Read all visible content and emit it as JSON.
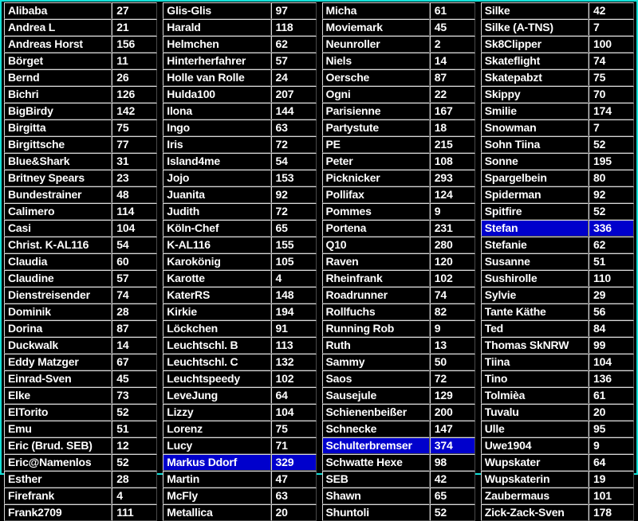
{
  "window": {
    "title": "Ranking Table",
    "border_color": "#13e0d8",
    "background": "#000000",
    "text_color": "#ffffff",
    "selection_color": "#0000cc"
  },
  "columns": [
    {
      "name": "column-1",
      "rows": [
        {
          "name": "Alibaba",
          "score": "27",
          "selected": false
        },
        {
          "name": "Andrea L",
          "score": "21",
          "selected": false
        },
        {
          "name": "Andreas Horst",
          "score": "156",
          "selected": false
        },
        {
          "name": "Börget",
          "score": "11",
          "selected": false
        },
        {
          "name": "Bernd",
          "score": "26",
          "selected": false
        },
        {
          "name": "Bichri",
          "score": "126",
          "selected": false
        },
        {
          "name": "BigBirdy",
          "score": "142",
          "selected": false
        },
        {
          "name": "Birgitta",
          "score": "75",
          "selected": false
        },
        {
          "name": "Birgittsche",
          "score": "77",
          "selected": false
        },
        {
          "name": "Blue&Shark",
          "score": "31",
          "selected": false
        },
        {
          "name": "Britney Spears",
          "score": "23",
          "selected": false
        },
        {
          "name": "Bundestrainer",
          "score": "48",
          "selected": false
        },
        {
          "name": "Calimero",
          "score": "114",
          "selected": false
        },
        {
          "name": "Casi",
          "score": "104",
          "selected": false
        },
        {
          "name": "Christ. K-AL116",
          "score": "54",
          "selected": false
        },
        {
          "name": "Claudia",
          "score": "60",
          "selected": false
        },
        {
          "name": "Claudine",
          "score": "57",
          "selected": false
        },
        {
          "name": "Dienstreisender",
          "score": "74",
          "selected": false
        },
        {
          "name": "Dominik",
          "score": "28",
          "selected": false
        },
        {
          "name": "Dorina",
          "score": "87",
          "selected": false
        },
        {
          "name": "Duckwalk",
          "score": "14",
          "selected": false
        },
        {
          "name": "Eddy Matzger",
          "score": "67",
          "selected": false
        },
        {
          "name": "Einrad-Sven",
          "score": "45",
          "selected": false
        },
        {
          "name": "Elke",
          "score": "73",
          "selected": false
        },
        {
          "name": "ElTorito",
          "score": "52",
          "selected": false
        },
        {
          "name": "Emu",
          "score": "51",
          "selected": false
        },
        {
          "name": "Eric (Brud. SEB)",
          "score": "12",
          "selected": false
        },
        {
          "name": "Eric@Namenlos",
          "score": "52",
          "selected": false
        },
        {
          "name": "Esther",
          "score": "28",
          "selected": false
        },
        {
          "name": "Firefrank",
          "score": "4",
          "selected": false
        },
        {
          "name": "Frank2709",
          "score": "111",
          "selected": false
        }
      ]
    },
    {
      "name": "column-2",
      "rows": [
        {
          "name": "Glis-Glis",
          "score": "97",
          "selected": false
        },
        {
          "name": "Harald",
          "score": "118",
          "selected": false
        },
        {
          "name": "Helmchen",
          "score": "62",
          "selected": false
        },
        {
          "name": "Hinterherfahrer",
          "score": "57",
          "selected": false
        },
        {
          "name": "Holle van Rolle",
          "score": "24",
          "selected": false
        },
        {
          "name": "Hulda100",
          "score": "207",
          "selected": false
        },
        {
          "name": "Ilona",
          "score": "144",
          "selected": false
        },
        {
          "name": "Ingo",
          "score": "63",
          "selected": false
        },
        {
          "name": "Iris",
          "score": "72",
          "selected": false
        },
        {
          "name": "Island4me",
          "score": "54",
          "selected": false
        },
        {
          "name": "Jojo",
          "score": "153",
          "selected": false
        },
        {
          "name": "Juanita",
          "score": "92",
          "selected": false
        },
        {
          "name": "Judith",
          "score": "72",
          "selected": false
        },
        {
          "name": "Köln-Chef",
          "score": "65",
          "selected": false
        },
        {
          "name": "K-AL116",
          "score": "155",
          "selected": false
        },
        {
          "name": "Karokönig",
          "score": "105",
          "selected": false
        },
        {
          "name": "Karotte",
          "score": "4",
          "selected": false
        },
        {
          "name": "KaterRS",
          "score": "148",
          "selected": false
        },
        {
          "name": "Kirkie",
          "score": "194",
          "selected": false
        },
        {
          "name": "Löckchen",
          "score": "91",
          "selected": false
        },
        {
          "name": "Leuchtschl. B",
          "score": "113",
          "selected": false
        },
        {
          "name": "Leuchtschl. C",
          "score": "132",
          "selected": false
        },
        {
          "name": "Leuchtspeedy",
          "score": "102",
          "selected": false
        },
        {
          "name": "LeveJung",
          "score": "64",
          "selected": false
        },
        {
          "name": "Lizzy",
          "score": "104",
          "selected": false
        },
        {
          "name": "Lorenz",
          "score": "75",
          "selected": false
        },
        {
          "name": "Lucy",
          "score": "71",
          "selected": false
        },
        {
          "name": "Markus Ddorf",
          "score": "329",
          "selected": true
        },
        {
          "name": "Martin",
          "score": "47",
          "selected": false
        },
        {
          "name": "McFly",
          "score": "63",
          "selected": false
        },
        {
          "name": "Metallica",
          "score": "20",
          "selected": false
        }
      ]
    },
    {
      "name": "column-3",
      "rows": [
        {
          "name": "Micha",
          "score": "61",
          "selected": false
        },
        {
          "name": "Moviemark",
          "score": "45",
          "selected": false
        },
        {
          "name": "Neunroller",
          "score": "2",
          "selected": false
        },
        {
          "name": "Niels",
          "score": "14",
          "selected": false
        },
        {
          "name": "Oersche",
          "score": "87",
          "selected": false
        },
        {
          "name": "Ogni",
          "score": "22",
          "selected": false
        },
        {
          "name": "Parisienne",
          "score": "167",
          "selected": false
        },
        {
          "name": "Partystute",
          "score": "18",
          "selected": false
        },
        {
          "name": "PE",
          "score": "215",
          "selected": false
        },
        {
          "name": "Peter",
          "score": "108",
          "selected": false
        },
        {
          "name": "Picknicker",
          "score": "293",
          "selected": false
        },
        {
          "name": "Pollifax",
          "score": "124",
          "selected": false
        },
        {
          "name": "Pommes",
          "score": "9",
          "selected": false
        },
        {
          "name": "Portena",
          "score": "231",
          "selected": false
        },
        {
          "name": "Q10",
          "score": "280",
          "selected": false
        },
        {
          "name": "Raven",
          "score": "120",
          "selected": false
        },
        {
          "name": "Rheinfrank",
          "score": "102",
          "selected": false
        },
        {
          "name": "Roadrunner",
          "score": "74",
          "selected": false
        },
        {
          "name": "Rollfuchs",
          "score": "82",
          "selected": false
        },
        {
          "name": "Running Rob",
          "score": "9",
          "selected": false
        },
        {
          "name": "Ruth",
          "score": "13",
          "selected": false
        },
        {
          "name": "Sammy",
          "score": "50",
          "selected": false
        },
        {
          "name": "Saos",
          "score": "72",
          "selected": false
        },
        {
          "name": "Sausejule",
          "score": "129",
          "selected": false
        },
        {
          "name": "Schienenbeißer",
          "score": "200",
          "selected": false
        },
        {
          "name": "Schnecke",
          "score": "147",
          "selected": false
        },
        {
          "name": "Schulterbremser",
          "score": "374",
          "selected": true
        },
        {
          "name": "Schwatte Hexe",
          "score": "98",
          "selected": false
        },
        {
          "name": "SEB",
          "score": "42",
          "selected": false
        },
        {
          "name": "Shawn",
          "score": "65",
          "selected": false
        },
        {
          "name": "Shuntoli",
          "score": "52",
          "selected": false
        }
      ]
    },
    {
      "name": "column-4",
      "rows": [
        {
          "name": "Silke",
          "score": "42",
          "selected": false
        },
        {
          "name": "Silke (A-TNS)",
          "score": "7",
          "selected": false
        },
        {
          "name": "Sk8Clipper",
          "score": "100",
          "selected": false
        },
        {
          "name": "Skateflight",
          "score": "74",
          "selected": false
        },
        {
          "name": "Skatepabzt",
          "score": "75",
          "selected": false
        },
        {
          "name": "Skippy",
          "score": "70",
          "selected": false
        },
        {
          "name": "Smilie",
          "score": "174",
          "selected": false
        },
        {
          "name": "Snowman",
          "score": "7",
          "selected": false
        },
        {
          "name": "Sohn Tiina",
          "score": "52",
          "selected": false
        },
        {
          "name": "Sonne",
          "score": "195",
          "selected": false
        },
        {
          "name": "Spargelbein",
          "score": "80",
          "selected": false
        },
        {
          "name": "Spiderman",
          "score": "92",
          "selected": false
        },
        {
          "name": "Spitfire",
          "score": "52",
          "selected": false
        },
        {
          "name": "Stefan",
          "score": "336",
          "selected": true
        },
        {
          "name": "Stefanie",
          "score": "62",
          "selected": false
        },
        {
          "name": "Susanne",
          "score": "51",
          "selected": false
        },
        {
          "name": "Sushirolle",
          "score": "110",
          "selected": false
        },
        {
          "name": "Sylvie",
          "score": "29",
          "selected": false
        },
        {
          "name": "Tante Käthe",
          "score": "56",
          "selected": false
        },
        {
          "name": "Ted",
          "score": "84",
          "selected": false
        },
        {
          "name": "Thomas SkNRW",
          "score": "99",
          "selected": false
        },
        {
          "name": "Tiina",
          "score": "104",
          "selected": false
        },
        {
          "name": "Tino",
          "score": "136",
          "selected": false
        },
        {
          "name": "Tolmièa",
          "score": "61",
          "selected": false
        },
        {
          "name": "Tuvalu",
          "score": "20",
          "selected": false
        },
        {
          "name": "Ulle",
          "score": "95",
          "selected": false
        },
        {
          "name": "Uwe1904",
          "score": "9",
          "selected": false
        },
        {
          "name": "Wupskater",
          "score": "64",
          "selected": false
        },
        {
          "name": "Wupskaterin",
          "score": "19",
          "selected": false
        },
        {
          "name": "Zaubermaus",
          "score": "101",
          "selected": false
        },
        {
          "name": "Zick-Zack-Sven",
          "score": "178",
          "selected": false
        }
      ]
    }
  ]
}
